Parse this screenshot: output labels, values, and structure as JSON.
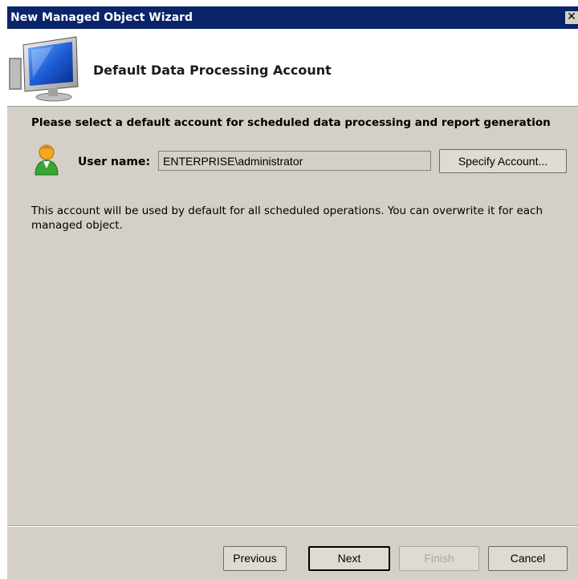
{
  "window": {
    "title": "New Managed Object Wizard",
    "close_glyph": "✕"
  },
  "header": {
    "title": "Default Data Processing Account",
    "icon": "monitor-icon"
  },
  "main": {
    "instruction": "Please select a default account for scheduled data processing and report generation",
    "user_icon": "user-icon",
    "user_label": "User name:",
    "user_value": "ENTERPRISE\\administrator",
    "specify_button": "Specify Account...",
    "info_text": "This account will be used by default for all scheduled operations. You can overwrite it for each managed object."
  },
  "footer": {
    "previous": "Previous",
    "next": "Next",
    "finish": "Finish",
    "cancel": "Cancel"
  },
  "colors": {
    "titlebar": "#0a246a",
    "dialog_bg": "#d4d0c8",
    "header_bg": "#ffffff",
    "disabled_text": "#a8a8a8"
  }
}
